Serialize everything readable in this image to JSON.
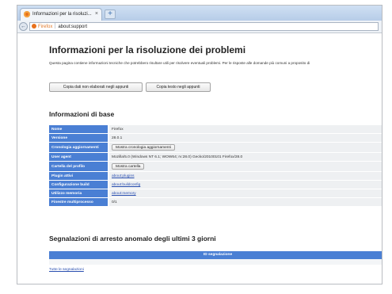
{
  "browser": {
    "tab_title": "Informazioni per la risoluzi...",
    "tab_close": "×",
    "new_tab": "+",
    "back": "←",
    "url_identity": "Firefox",
    "url": "about:support"
  },
  "page": {
    "title": "Informazioni per la risoluzione dei problemi",
    "description": "Questa pagina contiene informazioni tecniche che potrebbero risultare utili per risolvere eventuali problemi. Per le risposte alle domande più comuni a proposito di",
    "copy_raw_button": "Copia dati non elaborati negli appunti",
    "copy_text_button": "Copia testo negli appunti"
  },
  "basic_info": {
    "title": "Informazioni di base",
    "rows": [
      {
        "key": "Nome",
        "value": "Firefox"
      },
      {
        "key": "Versione",
        "value": "28.0.1"
      },
      {
        "key": "Cronologia aggiornamenti",
        "button": "Mostra cronologia aggiornamenti"
      },
      {
        "key": "User agent",
        "value": "Mozilla/5.0 (Windows NT 6.1; WOW64; rv:28.0) Gecko/20100101 Firefox/28.0"
      },
      {
        "key": "Cartella del profilo",
        "button": "Mostra cartella"
      },
      {
        "key": "Plugin attivi",
        "link": "about:plugins"
      },
      {
        "key": "Configurazione build",
        "link": "about:buildconfig"
      },
      {
        "key": "Utilizzo memoria",
        "link": "about:memory"
      },
      {
        "key": "Finestre multiprocesso",
        "value": "0/1"
      }
    ]
  },
  "crash_reports": {
    "title": "Segnalazioni di arresto anomalo degli ultimi 3 giorni",
    "column_header": "ID segnalazione",
    "all_reports_link": "Tutte le segnalazioni"
  }
}
